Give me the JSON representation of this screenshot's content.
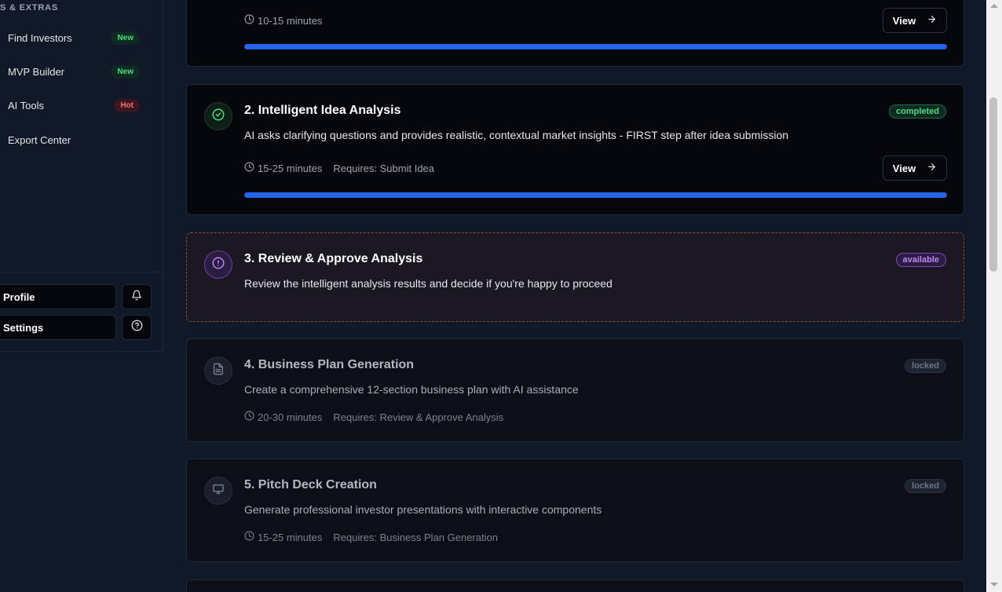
{
  "sidebar": {
    "section_label": "S & EXTRAS",
    "items": [
      {
        "label": "Find Investors",
        "badge": "New"
      },
      {
        "label": "MVP Builder",
        "badge": "New"
      },
      {
        "label": "AI Tools",
        "badge": "Hot"
      },
      {
        "label": "Export Center",
        "badge": null
      }
    ],
    "profile_label": "Profile",
    "settings_label": "Settings"
  },
  "steps": [
    {
      "title": "",
      "status": "",
      "time": "10-15 minutes",
      "view_label": "View",
      "progress": 1.0
    },
    {
      "title": "2. Intelligent Idea Analysis",
      "description": "AI asks clarifying questions and provides realistic, contextual market insights - FIRST step after idea submission",
      "status": "completed",
      "time": "15-25 minutes",
      "requires": "Requires: Submit Idea",
      "view_label": "View",
      "progress": 1.0
    },
    {
      "title": "3. Review & Approve Analysis",
      "description": "Review the intelligent analysis results and decide if you're happy to proceed",
      "status": "available"
    },
    {
      "title": "4. Business Plan Generation",
      "description": "Create a comprehensive 12-section business plan with AI assistance",
      "status": "locked",
      "time": "20-30 minutes",
      "requires": "Requires: Review & Approve Analysis"
    },
    {
      "title": "5. Pitch Deck Creation",
      "description": "Generate professional investor presentations with interactive components",
      "status": "locked",
      "time": "15-25 minutes",
      "requires": "Requires: Business Plan Generation"
    }
  ],
  "colors": {
    "accent_progress": "#2563eb",
    "completed": "#4ade80",
    "available": "#c084fc",
    "locked": "#6b7280"
  }
}
